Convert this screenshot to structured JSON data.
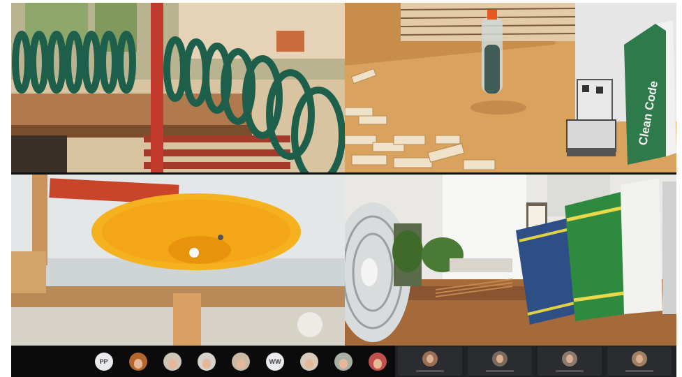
{
  "tiles": [
    {
      "id": "marble-run-spiral",
      "book_title": ""
    },
    {
      "id": "bottle-robot-dominoes",
      "book_title": "Clean Code"
    },
    {
      "id": "yellow-funnel-marble",
      "book_title": ""
    },
    {
      "id": "fan-books-shelf",
      "book_title": ""
    }
  ],
  "participants": [
    {
      "initials": "PP",
      "type": "initials",
      "color": "#e8eaed"
    },
    {
      "initials": "",
      "type": "photo",
      "color": "#b4672c"
    },
    {
      "initials": "",
      "type": "photo",
      "color": "#cfc6b8"
    },
    {
      "initials": "",
      "type": "photo",
      "color": "#d8d2cc"
    },
    {
      "initials": "",
      "type": "photo",
      "color": "#c9b9a6"
    },
    {
      "initials": "WW",
      "type": "initials",
      "color": "#e8eaed"
    },
    {
      "initials": "",
      "type": "photo",
      "color": "#d8c9bb"
    },
    {
      "initials": "",
      "type": "photo",
      "color": "#a9b0a6"
    },
    {
      "initials": "",
      "type": "photo",
      "color": "#c0504d"
    }
  ],
  "video_participants": [
    {
      "color": "#9a6f55"
    },
    {
      "color": "#7a6a5c"
    },
    {
      "color": "#8a7a6c"
    },
    {
      "color": "#a08060"
    }
  ]
}
